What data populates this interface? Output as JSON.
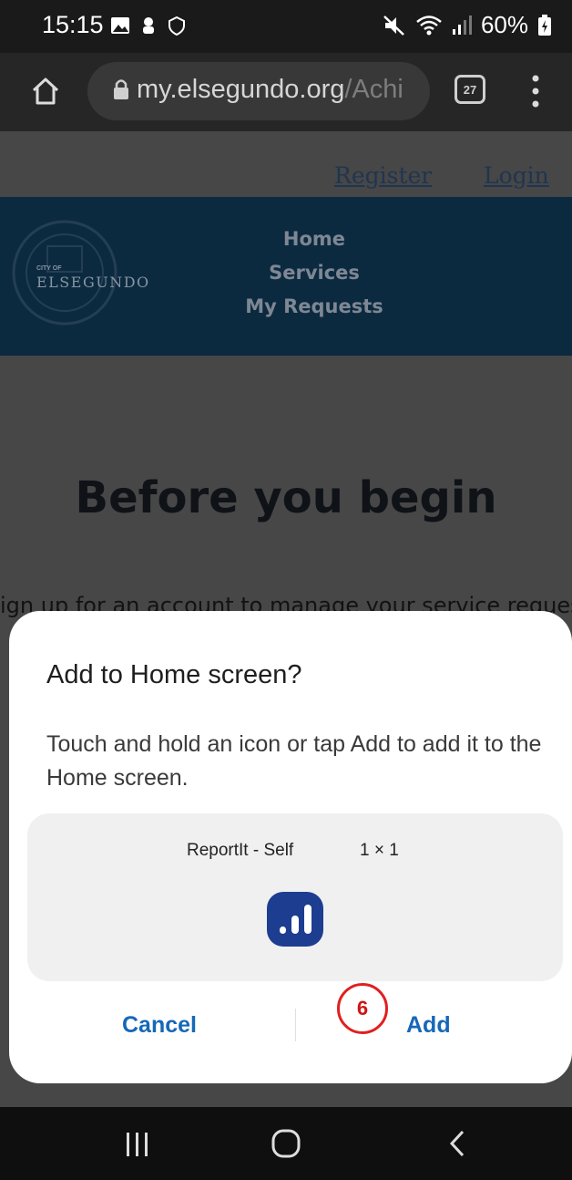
{
  "status_bar": {
    "time": "15:15",
    "battery": "60%"
  },
  "browser": {
    "url_host": "my.elsegundo.org",
    "url_path": "/Achi",
    "tab_count": "27"
  },
  "page": {
    "register_link": "Register",
    "login_link": "Login",
    "logo_small": "CITY OF",
    "logo_text": "ELSEGUNDO",
    "nav": [
      "Home",
      "Services",
      "My Requests"
    ],
    "headline": "Before you begin",
    "intro": "ign up for an account to manage your service reques"
  },
  "dialog": {
    "title": "Add to Home screen?",
    "body": "Touch and hold an icon or tap Add to add it to the Home screen.",
    "app_name": "ReportIt - Self",
    "app_size": "1 × 1",
    "cancel_label": "Cancel",
    "add_label": "Add",
    "step_marker": "6",
    "accent_color": "#1568b8",
    "marker_color": "#e02020"
  },
  "icons": [
    "home-icon",
    "lock-icon",
    "tabs-icon",
    "more-icon",
    "recents-icon",
    "home-nav-icon",
    "back-icon"
  ]
}
